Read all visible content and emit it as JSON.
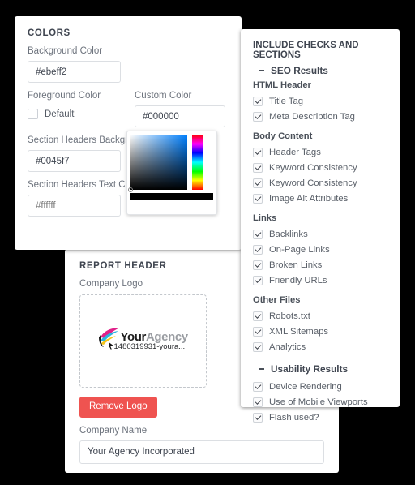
{
  "colors_panel": {
    "title": "COLORS",
    "background_color": {
      "label": "Background Color",
      "value": "#ebeff2"
    },
    "foreground_color": {
      "label": "Foreground Color",
      "checkbox_label": "Default",
      "checked": false
    },
    "custom_color": {
      "label": "Custom Color",
      "value": "#000000"
    },
    "section_headers_background": {
      "label": "Section Headers Background",
      "value": "#0045f7"
    },
    "section_headers_text": {
      "label": "Section Headers Text Color",
      "placeholder": "#ffffff",
      "value": ""
    }
  },
  "color_picker": {
    "selected_hex": "#000000",
    "current_swatch": "#000000",
    "sv_gradient_hue": "#0080ff"
  },
  "report_panel": {
    "title": "REPORT HEADER",
    "company_logo": {
      "label": "Company Logo",
      "alt_text": "1480319931-youra...",
      "wordmark_bold": "Your",
      "wordmark_light": "Agency"
    },
    "remove_logo_label": "Remove Logo",
    "remove_logo_color": "#ef5350",
    "company_name": {
      "label": "Company Name",
      "value": "Your Agency Incorporated"
    }
  },
  "checks_panel": {
    "title": "INCLUDE CHECKS AND SECTIONS",
    "sections": [
      {
        "collapse_label": "SEO Results",
        "collapsed_icon": "minus-icon",
        "groups": [
          {
            "name": "HTML Header",
            "items": [
              {
                "label": "Title Tag",
                "checked": true
              },
              {
                "label": "Meta Description Tag",
                "checked": true
              }
            ]
          },
          {
            "name": "Body Content",
            "items": [
              {
                "label": "Header Tags",
                "checked": true
              },
              {
                "label": "Keyword Consistency",
                "checked": true
              },
              {
                "label": "Keyword Consistency",
                "checked": true
              },
              {
                "label": "Image Alt Attributes",
                "checked": true
              }
            ]
          },
          {
            "name": "Links",
            "items": [
              {
                "label": "Backlinks",
                "checked": true
              },
              {
                "label": "On-Page Links",
                "checked": true
              },
              {
                "label": "Broken Links",
                "checked": true
              },
              {
                "label": "Friendly URLs",
                "checked": true
              }
            ]
          },
          {
            "name": "Other Files",
            "items": [
              {
                "label": "Robots.txt",
                "checked": true
              },
              {
                "label": "XML Sitemaps",
                "checked": true
              },
              {
                "label": "Analytics",
                "checked": true
              }
            ]
          }
        ]
      },
      {
        "collapse_label": "Usability Results",
        "collapsed_icon": "minus-icon",
        "groups": [
          {
            "name": "",
            "items": [
              {
                "label": "Device Rendering",
                "checked": true
              },
              {
                "label": "Use of Mobile Viewports",
                "checked": true
              },
              {
                "label": "Flash used?",
                "checked": true
              }
            ]
          }
        ]
      }
    ]
  }
}
